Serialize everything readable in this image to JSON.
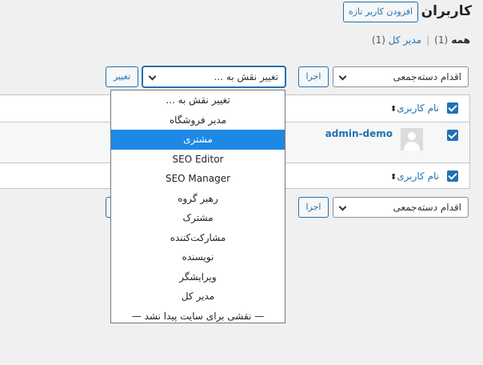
{
  "page": {
    "title": "کاربران",
    "add_new": "افزودن کاربر تازه"
  },
  "views": {
    "all_label": "همه",
    "all_count": "(1)",
    "admin_label": "مدیر کل",
    "admin_count": "(1)",
    "separator": "|"
  },
  "top_actions": {
    "bulk_select_value": "اقدام دسته‌جمعی",
    "apply_label": "اجرا",
    "role_select_value": "تغییر نقش به ...",
    "change_label": "تغییر"
  },
  "bottom_actions": {
    "bulk_select_value": "اقدام دسته‌جمعی",
    "apply_label": "اجرا"
  },
  "table": {
    "username_header": "نام کاربری",
    "sort_icon": "sort-icon",
    "rows": [
      {
        "username": "admin-demo",
        "avatar": "default-avatar-icon"
      }
    ]
  },
  "role_dropdown": {
    "options": [
      "تغییر نقش به ...",
      "مدیر فروشگاه",
      "مشتری",
      "SEO Editor",
      "SEO Manager",
      "رهبر گروه",
      "مشترک",
      "مشارکت‌کننده",
      "نویسنده",
      "ویرایشگر",
      "مدیر کل",
      "— نقشی برای سایت پیدا نشد —"
    ],
    "highlighted_index": 2
  },
  "colors": {
    "accent": "#2271b1",
    "highlight": "#1e88e5",
    "background": "#f0f0f1"
  }
}
